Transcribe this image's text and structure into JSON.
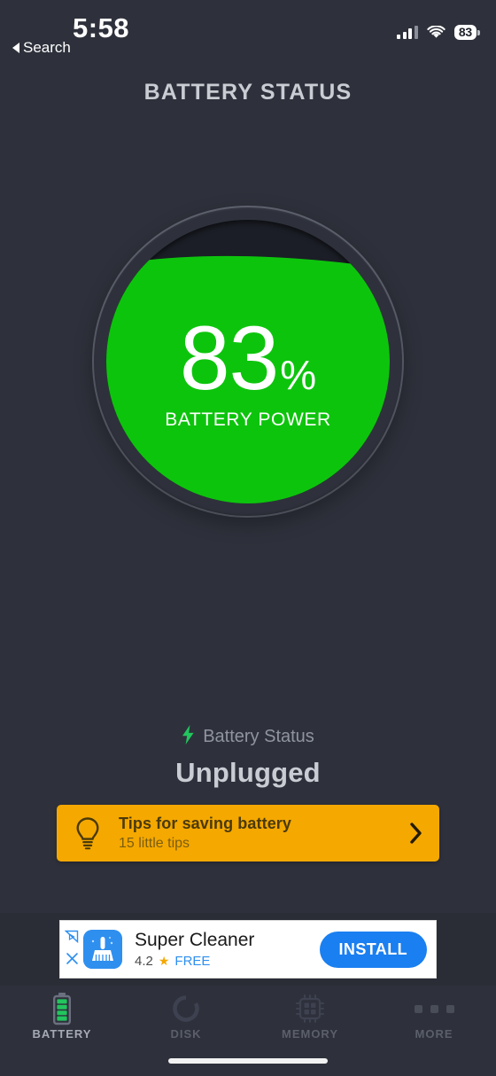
{
  "status_bar": {
    "time": "5:58",
    "back_label": "Search",
    "cellular_icon": "signal-bars-icon",
    "wifi_icon": "wifi-icon",
    "battery_percent": "83"
  },
  "header": {
    "title": "BATTERY STATUS"
  },
  "gauge": {
    "percent_number": "83",
    "percent_sign": "%",
    "caption": "BATTERY POWER",
    "fill_level": 83,
    "fill_color": "#0dc40d",
    "empty_color": "#1b1e26"
  },
  "battery_status": {
    "icon": "lightning-bolt-icon",
    "label": "Battery Status",
    "value": "Unplugged",
    "icon_color": "#22c55e"
  },
  "tips_banner": {
    "icon": "lightbulb-icon",
    "title": "Tips for saving battery",
    "subtitle": "15 little tips",
    "chevron": "chevron-right-icon",
    "background_color": "#f5a800"
  },
  "ad": {
    "adchoices_icon": "adchoices-icon",
    "close_icon": "close-icon",
    "app_icon": "broom-icon",
    "app_name": "Super Cleaner",
    "rating": "4.2",
    "star_icon": "star-icon",
    "price_label": "FREE",
    "install_label": "INSTALL",
    "install_color": "#1a7ff0"
  },
  "tabbar": {
    "items": [
      {
        "label": "BATTERY",
        "icon": "battery-icon",
        "active": true
      },
      {
        "label": "DISK",
        "icon": "disk-ring-icon",
        "active": false
      },
      {
        "label": "MEMORY",
        "icon": "memory-chip-icon",
        "active": false
      },
      {
        "label": "MORE",
        "icon": "more-dots-icon",
        "active": false
      }
    ]
  },
  "theme": {
    "background": "#2e313b",
    "accent_green": "#0dc40d",
    "accent_amber": "#f5a800"
  }
}
